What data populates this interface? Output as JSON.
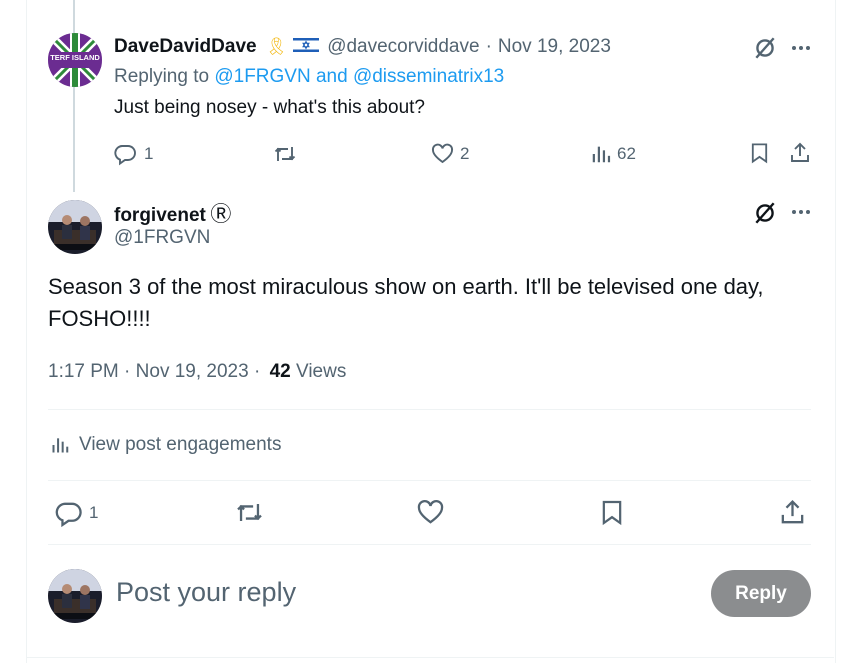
{
  "reply_tweet": {
    "author_name": "DaveDavidDave",
    "flag_emoji": "🇮🇱",
    "ribbon_emoji": "🎗",
    "handle": "@davecorviddave",
    "separator": "·",
    "date": "Nov 19, 2023",
    "replying_to_prefix": "Replying to ",
    "replying_to_users": "@1FRGVN and @disseminatrix13",
    "text": "Just being nosey - what's this about?",
    "avatar_text": "TERF ISLAND",
    "metrics": {
      "replies": "1",
      "likes": "2",
      "views": "62"
    }
  },
  "main_tweet": {
    "author_name": "forgivenet",
    "registered_mark": "Ⓡ",
    "handle": "@1FRGVN",
    "text": "Season 3 of the most miraculous show on earth. It'll be televised one day, FOSHO!!!!",
    "time": "1:17 PM",
    "dot1": "·",
    "date": "Nov 19, 2023",
    "dot2": "·",
    "views_count": "42",
    "views_label": "Views",
    "engagements_label": "View post engagements",
    "metrics": {
      "replies": "1"
    }
  },
  "composer": {
    "placeholder": "Post your reply",
    "reply_button": "Reply"
  },
  "colors": {
    "accent": "#1d9bf0",
    "muted": "#536471",
    "reply_button_bg": "#8b8d8f"
  }
}
